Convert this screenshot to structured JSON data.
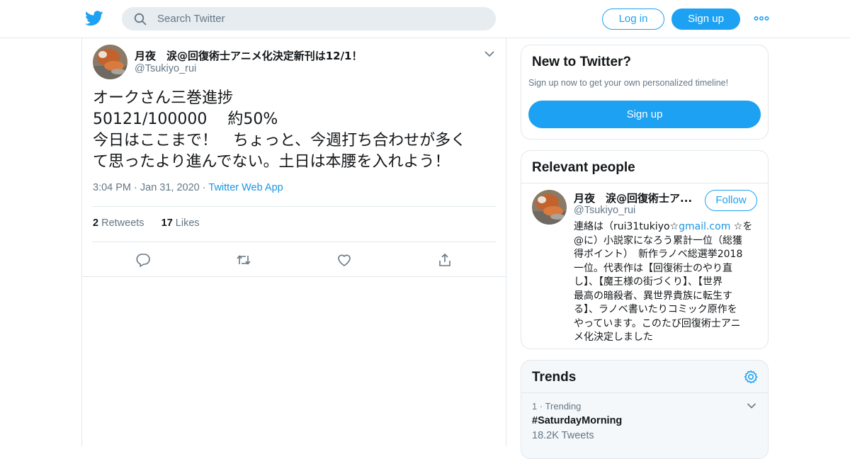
{
  "colors": {
    "accent": "#1da1f2",
    "link": "#1b95e0",
    "muted": "#657786",
    "border": "#e1e8ed"
  },
  "header": {
    "logo_icon": "twitter-bird-icon",
    "search": {
      "placeholder": "Search Twitter",
      "icon": "search-icon"
    },
    "login_label": "Log in",
    "signup_label": "Sign up",
    "more_icon": "more-dots-icon"
  },
  "tweet": {
    "author_name": "月夜　涙@回復術士アニメ化決定新刊は12/1！",
    "author_handle": "@Tsukiyo_rui",
    "text_lines": [
      "オークさん三巻進捗",
      "50121/100000　 約50%",
      "今日はここまで！　ちょっと、今週打ち合わせが多く",
      "て思ったより進んでない。土日は本腰を入れよう！"
    ],
    "time": "3:04 PM",
    "date": "Jan 31, 2020",
    "app": "Twitter Web App",
    "retweets_count": "2",
    "retweets_label": "Retweets",
    "likes_count": "17",
    "likes_label": "Likes",
    "actions": [
      "reply-icon",
      "retweet-icon",
      "like-icon",
      "share-icon"
    ]
  },
  "new_to_twitter": {
    "title": "New to Twitter?",
    "subtitle": "Sign up now to get your own personalized timeline!",
    "button_label": "Sign up"
  },
  "relevant_people": {
    "title": "Relevant people",
    "name": "月夜　涙@回復術士ア...",
    "handle": "@Tsukiyo_rui",
    "follow_label": "Follow",
    "bio": {
      "line1_prefix": "連絡は（rui31tukiyo☆",
      "line1_link": "gmail.com",
      "line1_suffix": " ☆を",
      "lines": [
        "@に）小説家になろう累計一位（総獲",
        "得ポイント）　新作ラノベ総選挙2018",
        "一位。代表作は【回復術士のやり直",
        "し】、【魔王様の街づくり】、【世界",
        "最高の暗殺者、異世界貴族に転生す",
        "る】、ラノベ書いたりコミック原作を",
        "やっています。このたび回復術士アニ",
        "メ化決定しました"
      ]
    }
  },
  "trends": {
    "title": "Trends",
    "items": [
      {
        "rank": "1",
        "context": "Trending",
        "name": "#SaturdayMorning",
        "count": "18.2K Tweets"
      }
    ]
  }
}
